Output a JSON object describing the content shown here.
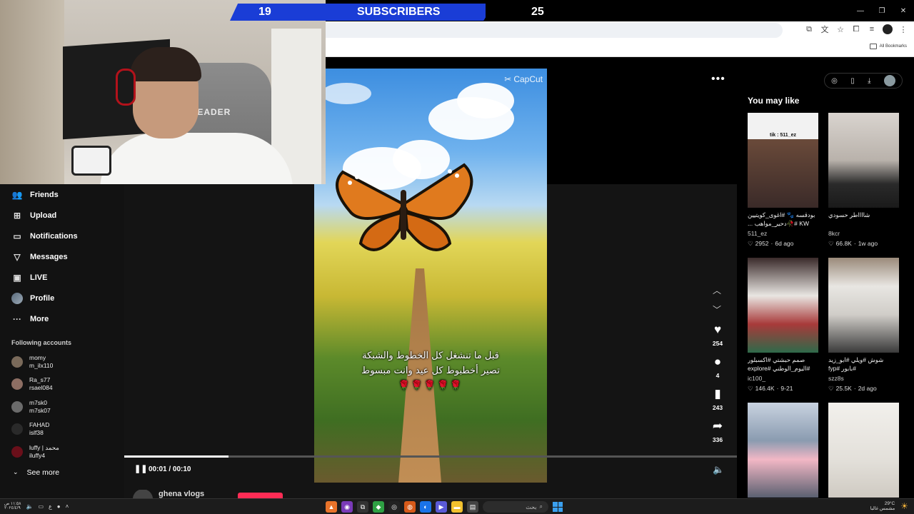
{
  "overlay": {
    "sub_count_left": "19",
    "sub_label": "SUBSCRIBERS",
    "sub_count_right": "25",
    "chair_brand": "LEADER"
  },
  "browser": {
    "bookmarks_label": "All Bookmarks",
    "toolbar_icons": [
      "screen-capture-icon",
      "translate-icon",
      "star-icon",
      "extensions-icon",
      "media-icon",
      "profile-icon",
      "menu-icon"
    ]
  },
  "sidebar": {
    "nav": [
      {
        "label": "Friends",
        "icon": "friends-icon"
      },
      {
        "label": "Upload",
        "icon": "upload-icon"
      },
      {
        "label": "Notifications",
        "icon": "notifications-icon"
      },
      {
        "label": "Messages",
        "icon": "messages-icon"
      },
      {
        "label": "LIVE",
        "icon": "live-icon"
      },
      {
        "label": "Profile",
        "icon": "profile-icon"
      },
      {
        "label": "More",
        "icon": "more-icon"
      }
    ],
    "following_title": "Following accounts",
    "following": [
      {
        "name": "momy",
        "handle": "m_ilx110",
        "color": "#7a6a5a"
      },
      {
        "name": "Ra_s77",
        "handle": "rsael084",
        "color": "#8d6e63"
      },
      {
        "name": "m7sk0",
        "handle": "m7sk07",
        "color": "#6b6b6b"
      },
      {
        "name": "FAHAD",
        "handle": "islf38",
        "color": "#2a2a2a"
      },
      {
        "name": "luffy | محمد",
        "handle": "iluffy4",
        "color": "#6a0f1a"
      }
    ],
    "see_more": "See more"
  },
  "player": {
    "watermark": "CapCut",
    "caption_line1": "قبل ما تنشغل كل الخطوط والشبكة",
    "caption_line2": "تصير أخطبوط كل عيد وانت مبسوط",
    "caption_hearts": "🌹🌹🌹🌹🌹",
    "likes": "254",
    "comments": "4",
    "saves": "243",
    "shares": "336",
    "time": "00:01 / 00:10",
    "progress": 0.17,
    "author_peek": "ghena vlogs"
  },
  "right_panel": {
    "title": "You may like",
    "cards": [
      {
        "title": "بودقسه 🐾 #اغوى_كويتيين KW #🥀دحير_مواهب ...",
        "user": "511_ez",
        "likes": "2952",
        "date": "6d ago",
        "thumb_text": "tik : 511_ez",
        "bg": "linear-gradient(180deg,#f2f2f2 0%,#f2f2f2 28%,#6a4a3a 28%,#3a2a28 100%)"
      },
      {
        "title": "شااااطر حسودي",
        "user": "8kcr",
        "likes": "66.8K",
        "date": "1w ago",
        "thumb_text": "",
        "bg": "linear-gradient(180deg,#d9d4cf 0%,#b9b2ab 50%,#2a2a2a 75%,#1a1a1a 100%)"
      },
      {
        "title": "صمم حبشتي #اكسبلور #اليوم_الوطني #explore",
        "user": "ic100_",
        "likes": "146.4K",
        "date": "9-21",
        "thumb_text": "",
        "bg": "linear-gradient(180deg,#3a2a2a 0%,#e9e6e2 40%,#a83a3a 70%,#2e6a4a 100%)"
      },
      {
        "title": "شوش #ويلي #ابو_زيد #بابور #fyp",
        "user": "szz8s",
        "likes": "25.5K",
        "date": "2d ago",
        "thumb_text": "",
        "bg": "linear-gradient(180deg,#9a8a7a 0%,#e8e6e2 30%,#d0cdc8 60%,#3a3a3a 100%)"
      },
      {
        "title": "",
        "user": "",
        "likes": "",
        "date": "",
        "thumb_text": "",
        "bg": "linear-gradient(180deg,#c9d3e0 0%,#8a9bb0 40%,#f2b7c5 60%,#5a6070 100%)"
      },
      {
        "title": "",
        "user": "",
        "likes": "",
        "date": "",
        "thumb_text": "",
        "bg": "linear-gradient(180deg,#f2f0ec 0%,#e3e0da 60%,#cfcac2 100%)"
      }
    ]
  },
  "taskbar": {
    "search_text": "بحث",
    "time": "١١:٥٨ ص",
    "date": "٢٠٢٤/٤/٩",
    "weather": "29°C",
    "weather_desc": "مشمس غالبا",
    "lang": "ع"
  }
}
